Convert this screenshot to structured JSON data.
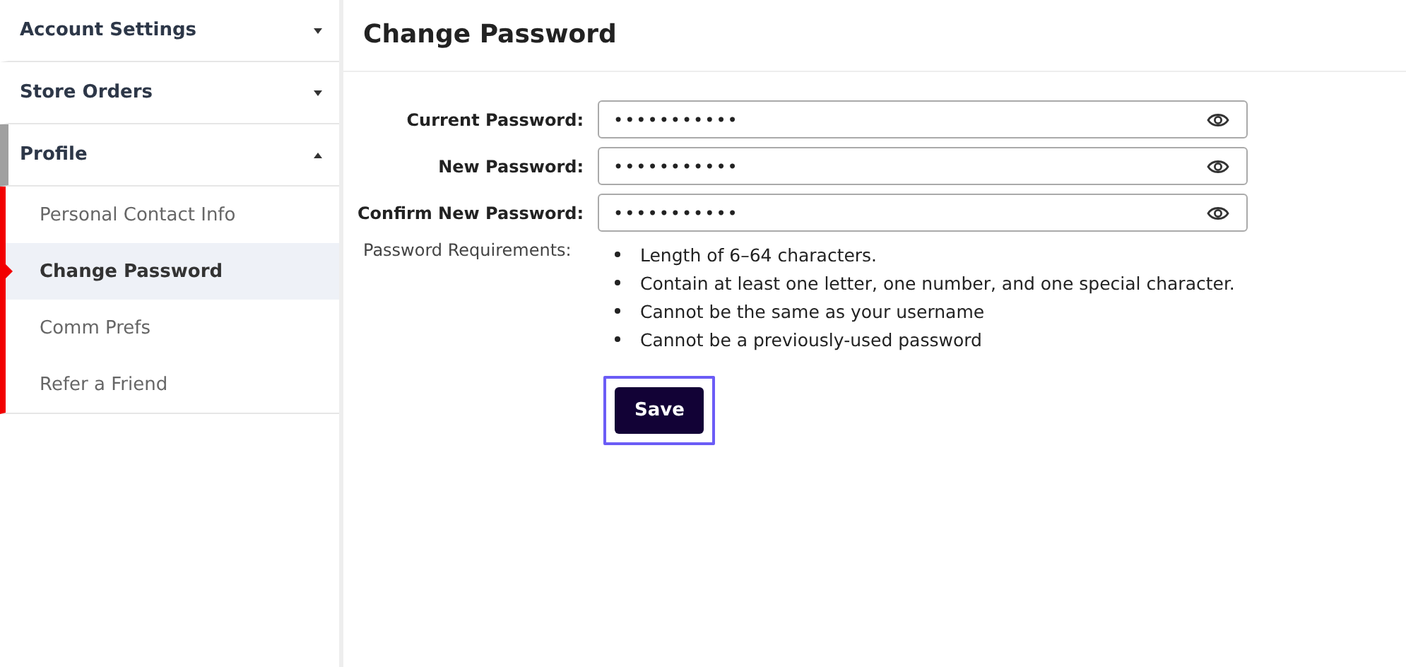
{
  "sidebar": {
    "sections": [
      {
        "label": "Account Settings",
        "expanded": false,
        "selected": false
      },
      {
        "label": "Store Orders",
        "expanded": false,
        "selected": false
      },
      {
        "label": "Profile",
        "expanded": true,
        "selected": true,
        "items": [
          {
            "label": "Personal Contact Info",
            "selected": false
          },
          {
            "label": "Change Password",
            "selected": true
          },
          {
            "label": "Comm Prefs",
            "selected": false
          },
          {
            "label": "Refer a Friend",
            "selected": false
          }
        ]
      }
    ]
  },
  "page_title": "Change Password",
  "fields": [
    {
      "label": "Current Password:",
      "value": "•••••••••••"
    },
    {
      "label": "New Password:",
      "value": "•••••••••••"
    },
    {
      "label": "Confirm New Password:",
      "value": "•••••••••••"
    }
  ],
  "requirements": {
    "label": "Password Requirements:",
    "items": [
      "Length of 6–64 characters.",
      "Contain at least one letter, one number, and one special character.",
      "Cannot be the same as your username",
      "Cannot be a previously-used password"
    ]
  },
  "save_button": {
    "label": "Save",
    "focused": true
  }
}
